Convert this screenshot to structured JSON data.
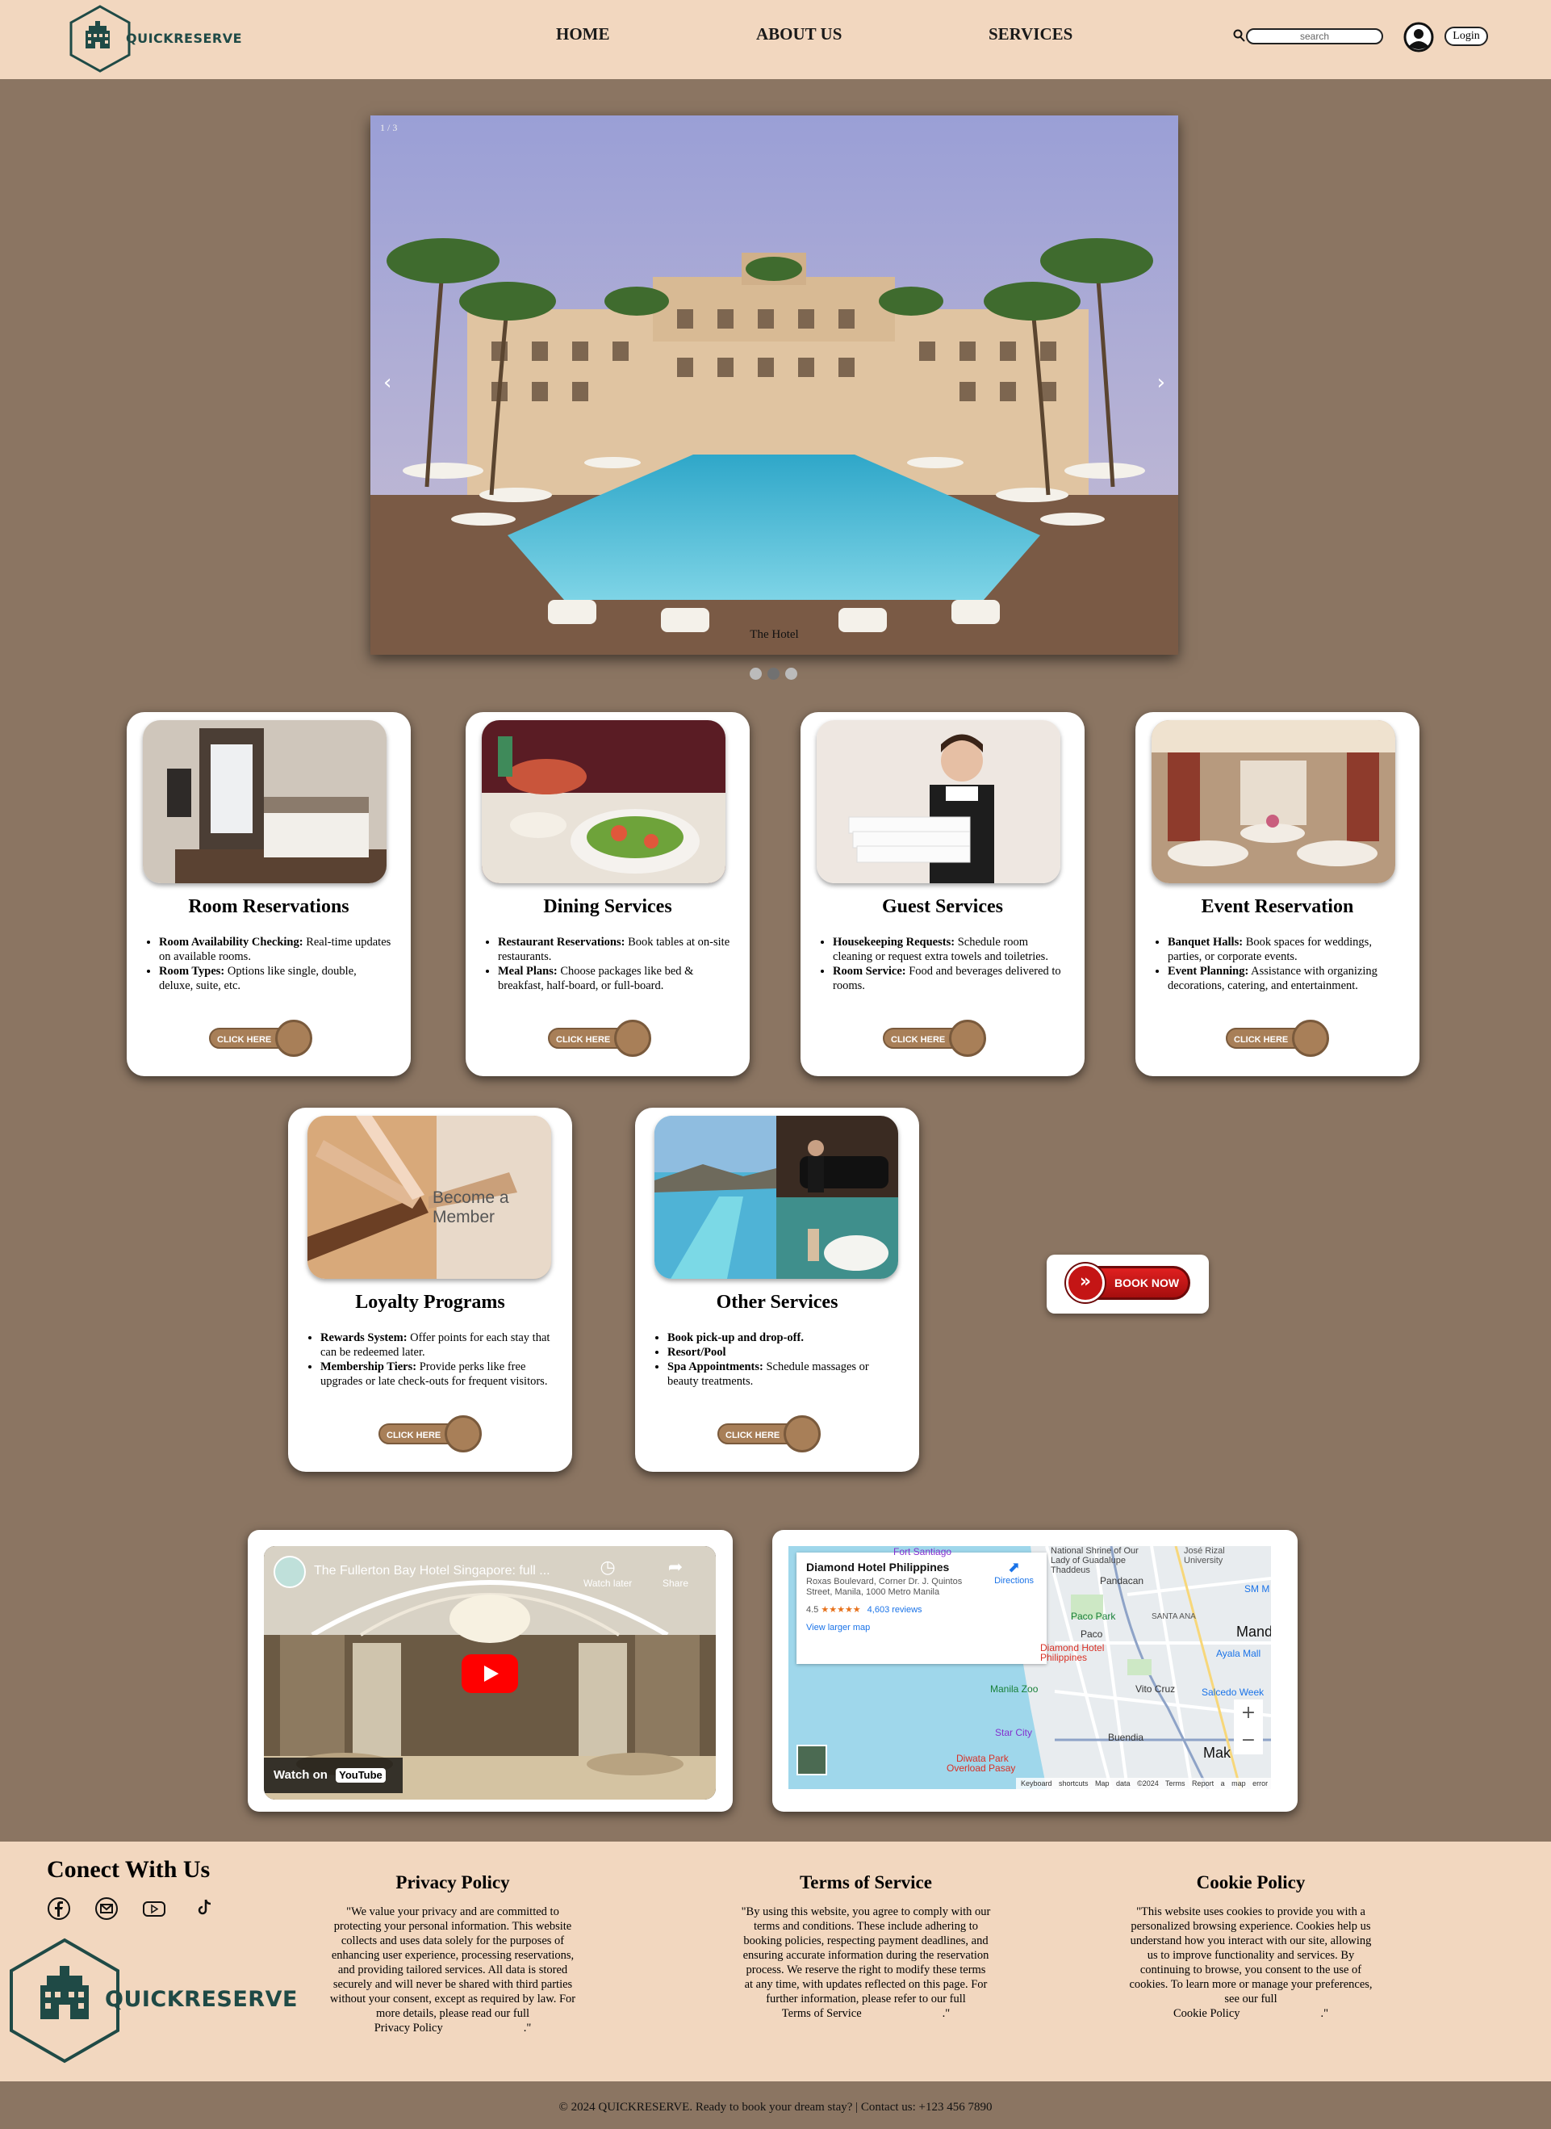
{
  "brand": {
    "name": "QUICKRESERVE"
  },
  "nav": {
    "home": "HOME",
    "about": "ABOUT US",
    "services": "SERVICES",
    "search_placeholder": "search",
    "login": "Login"
  },
  "slider": {
    "counter": "1 / 3",
    "caption": "The Hotel",
    "dot_count": 3,
    "active_dot": 1
  },
  "cards": [
    {
      "title": "Room Reservations",
      "items": [
        {
          "b": "Room Availability Checking:",
          "t": " Real-time updates on available rooms."
        },
        {
          "b": "Room Types:",
          "t": " Options like single, double, deluxe, suite, etc."
        }
      ],
      "button": "CLICK HERE"
    },
    {
      "title": "Dining Services",
      "items": [
        {
          "b": "Restaurant Reservations:",
          "t": " Book tables at on-site restaurants."
        },
        {
          "b": "Meal Plans:",
          "t": " Choose packages like bed & breakfast, half-board, or full-board."
        }
      ],
      "button": "CLICK HERE"
    },
    {
      "title": "Guest Services",
      "items": [
        {
          "b": "Housekeeping Requests:",
          "t": " Schedule room cleaning or request extra towels and toiletries."
        },
        {
          "b": "Room Service:",
          "t": " Food and beverages delivered to rooms."
        }
      ],
      "button": "CLICK HERE"
    },
    {
      "title": "Event Reservation",
      "items": [
        {
          "b": "Banquet Halls:",
          "t": " Book spaces for weddings, parties, or corporate events."
        },
        {
          "b": "Event Planning:",
          "t": " Assistance with organizing decorations, catering, and entertainment."
        }
      ],
      "button": "CLICK HERE"
    },
    {
      "title": "Loyalty Programs",
      "items": [
        {
          "b": "Rewards System:",
          "t": " Offer points for each stay that can be redeemed later."
        },
        {
          "b": "Membership Tiers:",
          "t": " Provide perks like free upgrades or late check-outs for frequent visitors."
        }
      ],
      "button": "CLICK HERE",
      "image_text": "Become a Member"
    },
    {
      "title": "Other Services",
      "items": [
        {
          "b": "Book pick-up and drop-off.",
          "t": ""
        },
        {
          "b": "Resort/Pool",
          "t": ""
        },
        {
          "b": "Spa Appointments:",
          "t": " Schedule massages or beauty treatments."
        }
      ],
      "button": "CLICK HERE"
    }
  ],
  "book_now": "BOOK NOW",
  "video": {
    "title": "The Fullerton Bay Hotel Singapore: full ...",
    "watch_later": "Watch later",
    "share": "Share",
    "watch_on": "Watch on",
    "youtube": "YouTube"
  },
  "map": {
    "place": "Diamond Hotel Philippines",
    "address": "Roxas Boulevard, Corner Dr. J. Quintos Street, Manila, 1000 Metro Manila",
    "rating": "4.5",
    "stars": "★★★★★",
    "reviews": "4,603 reviews",
    "directions": "Directions",
    "larger": "View larger map",
    "labels": [
      "Fort Santiago",
      "National Shrine of Our Lady of Guadalupe Thaddeus",
      "José Rizal University",
      "Pandacan",
      "SM M",
      "Paco Park",
      "SANTA ANA",
      "Mand",
      "Paco",
      "Diamond Hotel Philippines",
      "Ayala Mall",
      "Manila Zoo",
      "Vito Cruz",
      "Salcedo Week",
      "Star City",
      "Buendia",
      "Diwata Park",
      "Overload Pasay",
      "Mak"
    ],
    "footer": "Keyboard shortcuts   Map data ©2024   Terms   Report a map error"
  },
  "footer": {
    "connect": "Conect With Us",
    "privacy": {
      "title": "Privacy Policy",
      "text": "\"We value your privacy and are committed to protecting your personal information. This website collects and uses data solely for the purposes of enhancing user experience, processing reservations, and providing tailored services. All data is stored securely and will never be shared with third parties without your consent, except as required by law. For more details, please read our full",
      "link": "Privacy Policy",
      "end": ".\""
    },
    "terms": {
      "title": "Terms of Service",
      "text": "\"By using this website, you agree to comply with our terms and conditions. These include adhering to booking policies, respecting payment deadlines, and ensuring accurate information during the reservation process. We reserve the right to modify these terms at any time, with updates reflected on this page. For further information, please refer to our full",
      "link": "Terms of Service",
      "end": ".\""
    },
    "cookie": {
      "title": "Cookie Policy",
      "text": "\"This website uses cookies to provide you with a personalized browsing experience. Cookies help us understand how you interact with our site, allowing us to improve functionality and services. By continuing to browse, you consent to the use of cookies. To learn more or manage your preferences, see our full",
      "link": "Cookie Policy",
      "end": ".\""
    },
    "copyright": "© 2024 QUICKRESERVE. Ready to book your dream stay? | Contact us: +123 456 7890"
  }
}
